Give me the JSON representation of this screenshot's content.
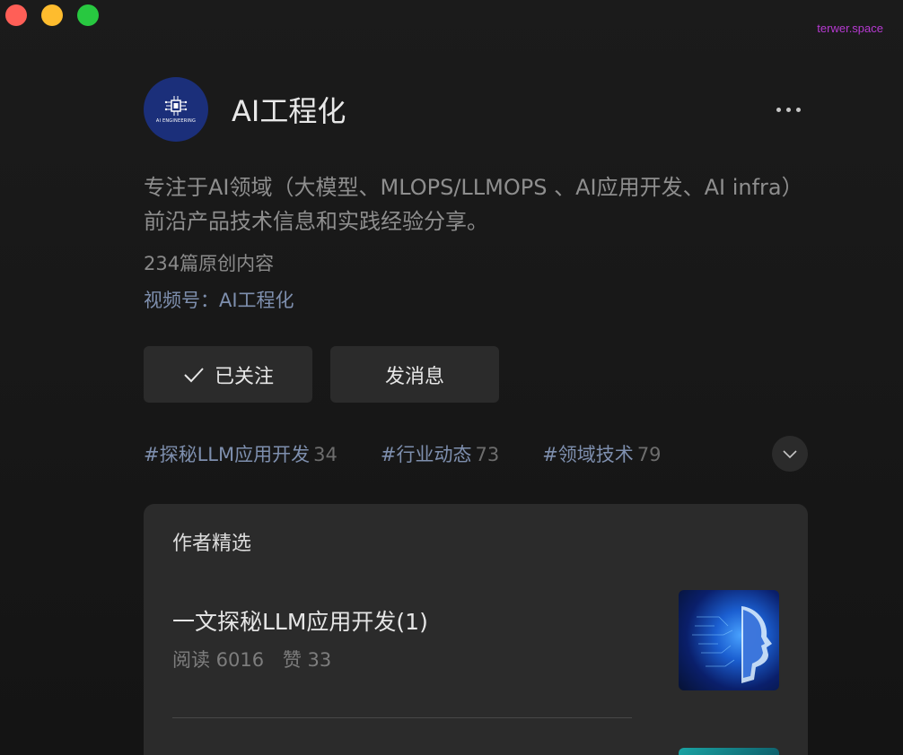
{
  "watermark": "terwer.space",
  "account": {
    "name": "AI工程化",
    "avatar_text": "AI ENGINEERING",
    "description": "专注于AI领域（大模型、MLOPS/LLMOPS 、AI应用开发、AI infra）前沿产品技术信息和实践经验分享。",
    "original_count": "234篇原创内容",
    "channel": "视频号：AI工程化"
  },
  "buttons": {
    "follow_label": "已关注",
    "message_label": "发消息"
  },
  "tags": [
    {
      "name": "#探秘LLM应用开发",
      "count": "34"
    },
    {
      "name": "#行业动态",
      "count": "73"
    },
    {
      "name": "#领域技术",
      "count": "79"
    }
  ],
  "picks": {
    "title": "作者精选",
    "articles": [
      {
        "title": "一文探秘LLM应用开发(1)",
        "reads": "阅读 6016",
        "likes": "赞 33"
      }
    ]
  },
  "colors": {
    "traffic_close": "#ff5f57",
    "traffic_min": "#febc2e",
    "traffic_max": "#28c840",
    "link_blue": "#7e8fae",
    "watermark": "#b63ad1"
  },
  "icons": [
    "more-icon",
    "check-icon",
    "chevron-down-icon"
  ]
}
